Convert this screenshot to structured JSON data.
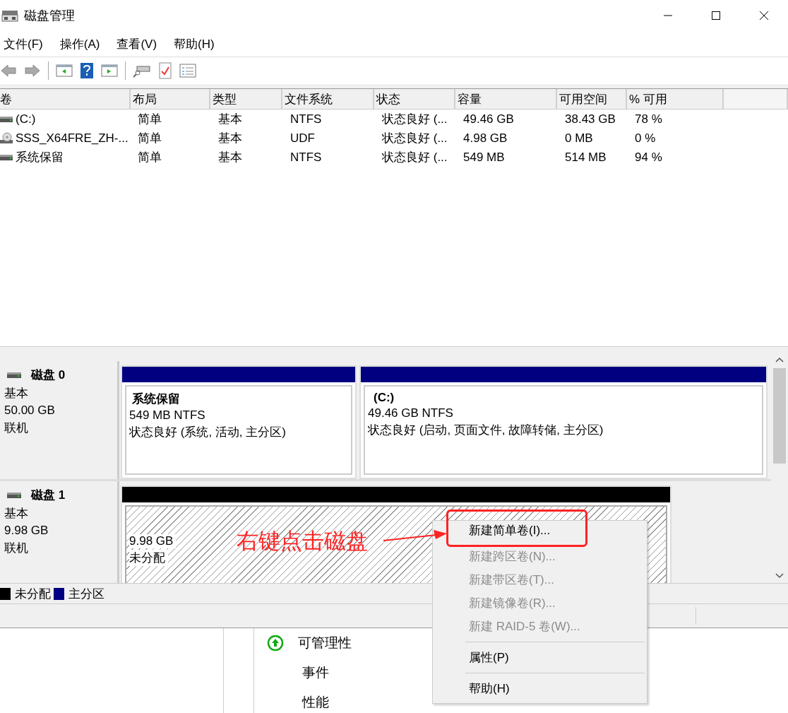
{
  "window": {
    "title": "磁盘管理"
  },
  "menu_bar": [
    "文件(F)",
    "操作(A)",
    "查看(V)",
    "帮助(H)"
  ],
  "volume_table": {
    "columns": [
      "卷",
      "布局",
      "类型",
      "文件系统",
      "状态",
      "容量",
      "可用空间",
      "% 可用"
    ],
    "rows": [
      {
        "kind": "disk",
        "cells": [
          "(C:)",
          "简单",
          "基本",
          "NTFS",
          "状态良好 (...",
          "49.46 GB",
          "38.43 GB",
          "78 %"
        ]
      },
      {
        "kind": "optical",
        "cells": [
          "SSS_X64FRE_ZH-...",
          "简单",
          "基本",
          "UDF",
          "状态良好 (...",
          "4.98 GB",
          "0 MB",
          "0 %"
        ]
      },
      {
        "kind": "disk",
        "cells": [
          "系统保留",
          "简单",
          "基本",
          "NTFS",
          "状态良好 (...",
          "549 MB",
          "514 MB",
          "94 %"
        ]
      }
    ]
  },
  "disks": [
    {
      "name": "磁盘 0",
      "type": "基本",
      "size": "50.00 GB",
      "status": "联机",
      "partitions": [
        {
          "kind": "primary",
          "color": "#000080",
          "name": "系统保留",
          "size": "549 MB NTFS",
          "status": "状态良好 (系统, 活动, 主分区)"
        },
        {
          "kind": "primary",
          "color": "#000080",
          "name": "(C:)",
          "size": "49.46 GB NTFS",
          "status": "状态良好 (启动, 页面文件, 故障转储, 主分区)"
        }
      ]
    },
    {
      "name": "磁盘 1",
      "type": "基本",
      "size": "9.98 GB",
      "status": "联机",
      "partitions": [
        {
          "kind": "unallocated",
          "color": "#000000",
          "size": "9.98 GB",
          "status": "未分配"
        }
      ]
    }
  ],
  "legend": [
    {
      "color": "#000000",
      "label": "未分配"
    },
    {
      "color": "#000080",
      "label": "主分区"
    }
  ],
  "bottom_panel": [
    {
      "kind": "heading",
      "label": "可管理性"
    },
    {
      "kind": "link",
      "label": "事件"
    },
    {
      "kind": "link",
      "label": "性能"
    }
  ],
  "context_menu": [
    {
      "kind": "item",
      "label": "新建简单卷(I)...",
      "disabled": false,
      "boxed": true
    },
    {
      "kind": "item",
      "label": "新建跨区卷(N)...",
      "disabled": true,
      "boxed": false
    },
    {
      "kind": "item",
      "label": "新建带区卷(T)...",
      "disabled": true,
      "boxed": false
    },
    {
      "kind": "item",
      "label": "新建镜像卷(R)...",
      "disabled": true,
      "boxed": false
    },
    {
      "kind": "item",
      "label": "新建 RAID-5 卷(W)...",
      "disabled": true,
      "boxed": false
    },
    {
      "kind": "separator"
    },
    {
      "kind": "item",
      "label": "属性(P)",
      "disabled": false,
      "boxed": false
    },
    {
      "kind": "separator"
    },
    {
      "kind": "item",
      "label": "帮助(H)",
      "disabled": false,
      "boxed": false
    }
  ],
  "annotation": {
    "text": "右键点击磁盘"
  }
}
